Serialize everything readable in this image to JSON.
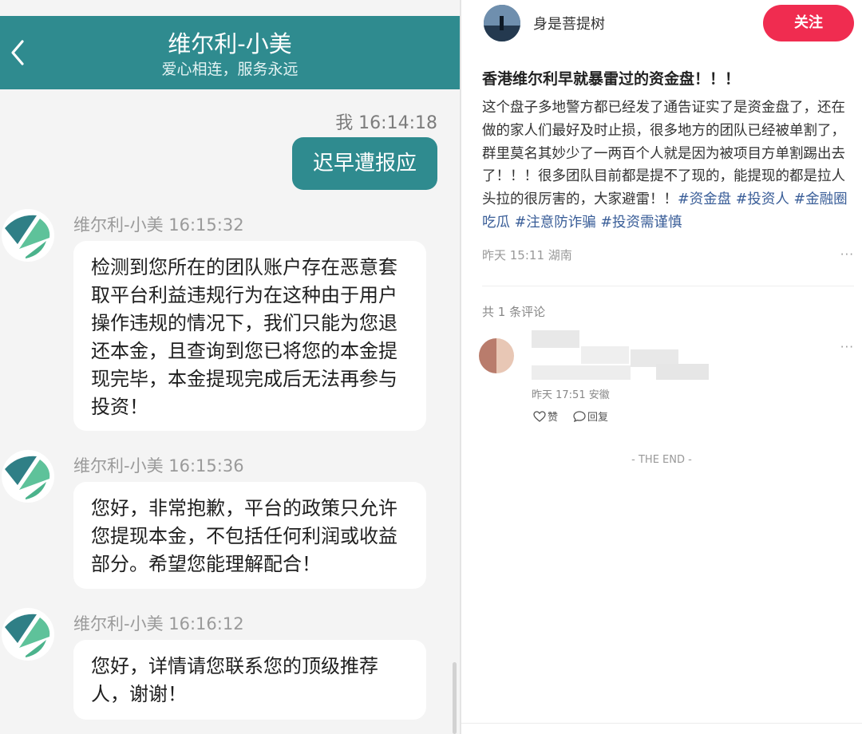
{
  "chat": {
    "title": "维尔利-小美",
    "subtitle": "爱心相连，服务永远",
    "accent_color": "#2f8b8f",
    "my_message": {
      "meta": "我 16:14:18",
      "text": "迟早遭报应"
    },
    "messages": [
      {
        "meta": "维尔利-小美 16:15:32",
        "text": "检测到您所在的团队账户存在恶意套取平台利益违规行为在这种由于用户操作违规的情况下，我们只能为您退还本金，且查询到您已将您的本金提现完毕，本金提现完成后无法再参与投资！"
      },
      {
        "meta": "维尔利-小美 16:15:36",
        "text": "您好，非常抱歉，平台的政策只允许您提现本金，不包括任何利润或收益部分。希望您能理解配合！"
      },
      {
        "meta": "维尔利-小美 16:16:12",
        "text": "您好，详情请您联系您的顶级推荐人，谢谢！"
      }
    ]
  },
  "post": {
    "username": "身是菩提树",
    "follow_label": "关注",
    "title": "香港维尔利早就暴雷过的资金盘！！！",
    "body": "这个盘子多地警方都已经发了通告证实了是资金盘了，还在做的家人们最好及时止损，很多地方的团队已经被单割了，群里莫名其妙少了一两百个人就是因为被项目方单割踢出去了！！！很多团队目前都是提不了现的，能提现的都是拉人头拉的很厉害的，大家避雷！！",
    "tags": [
      "#资金盘",
      "#投资人",
      "#金融圈吃瓜",
      "#注意防诈骗",
      "#投资需谨慎"
    ],
    "time": "昨天 15:11 湖南",
    "more": "···",
    "comment_count": "共 1 条评论",
    "comment": {
      "meta": "昨天 17:51 安徽",
      "like_label": "赞",
      "reply_label": "回复",
      "more": "···"
    },
    "end_text": "- THE END -",
    "follow_color": "#f02c50",
    "tag_color": "#3a5e98"
  }
}
